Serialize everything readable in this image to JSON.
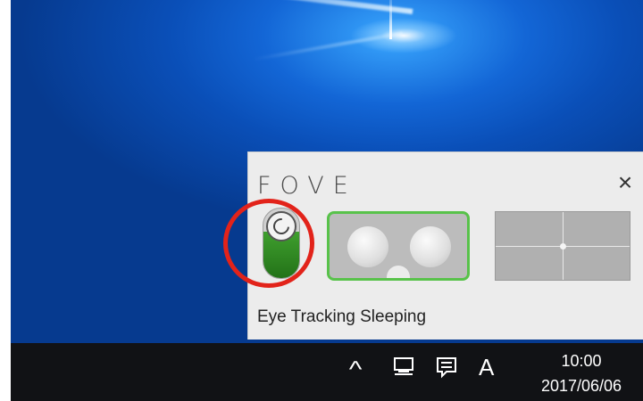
{
  "popup": {
    "logo": "FOVE",
    "close_label": "×",
    "toggle_state": "sleeping",
    "modes": [
      "headset-view",
      "calibration-grid"
    ],
    "status_text": "Eye Tracking Sleeping",
    "highlight_color": "#e2231a",
    "active_color": "#3f9f2e"
  },
  "taskbar": {
    "tray_icons": [
      "chevron-up-icon",
      "network-monitor-icon",
      "action-center-icon"
    ],
    "ime_indicator": "A",
    "time": "10:00",
    "date": "2017/06/06"
  }
}
